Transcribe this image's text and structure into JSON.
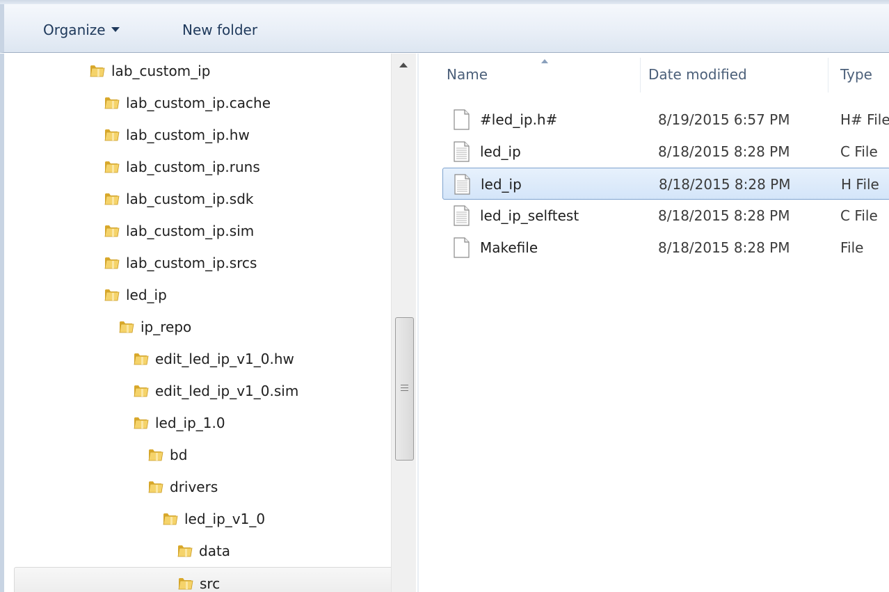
{
  "toolbar": {
    "organize_label": "Organize",
    "new_folder_label": "New folder"
  },
  "nav": {
    "items": [
      {
        "label": "lab_custom_ip",
        "depth": 0
      },
      {
        "label": "lab_custom_ip.cache",
        "depth": 1
      },
      {
        "label": "lab_custom_ip.hw",
        "depth": 1
      },
      {
        "label": "lab_custom_ip.runs",
        "depth": 1
      },
      {
        "label": "lab_custom_ip.sdk",
        "depth": 1
      },
      {
        "label": "lab_custom_ip.sim",
        "depth": 1
      },
      {
        "label": "lab_custom_ip.srcs",
        "depth": 1
      },
      {
        "label": "led_ip",
        "depth": 1
      },
      {
        "label": "ip_repo",
        "depth": 2
      },
      {
        "label": "edit_led_ip_v1_0.hw",
        "depth": 3
      },
      {
        "label": "edit_led_ip_v1_0.sim",
        "depth": 3
      },
      {
        "label": "led_ip_1.0",
        "depth": 3
      },
      {
        "label": "bd",
        "depth": 4
      },
      {
        "label": "drivers",
        "depth": 4
      },
      {
        "label": "led_ip_v1_0",
        "depth": 5
      },
      {
        "label": "data",
        "depth": 6
      },
      {
        "label": "src",
        "depth": 6,
        "selected": true
      }
    ]
  },
  "columns": {
    "name": "Name",
    "date_modified": "Date modified",
    "type": "Type"
  },
  "files": [
    {
      "name": "#led_ip.h#",
      "date": "8/19/2015 6:57 PM",
      "type": "H# File",
      "icon": "blank-file-icon"
    },
    {
      "name": "led_ip",
      "date": "8/18/2015 8:28 PM",
      "type": "C File",
      "icon": "text-file-icon"
    },
    {
      "name": "led_ip",
      "date": "8/18/2015 8:28 PM",
      "type": "H File",
      "icon": "text-file-icon",
      "selected": true
    },
    {
      "name": "led_ip_selftest",
      "date": "8/18/2015 8:28 PM",
      "type": "C File",
      "icon": "text-file-icon"
    },
    {
      "name": "Makefile",
      "date": "8/18/2015 8:28 PM",
      "type": "File",
      "icon": "blank-file-icon"
    }
  ],
  "colors": {
    "selection_blue": "#cce3fb",
    "selection_border": "#7da2ce",
    "toolbar_text": "#1e395b",
    "folder_yellow": "#f2c94c"
  }
}
